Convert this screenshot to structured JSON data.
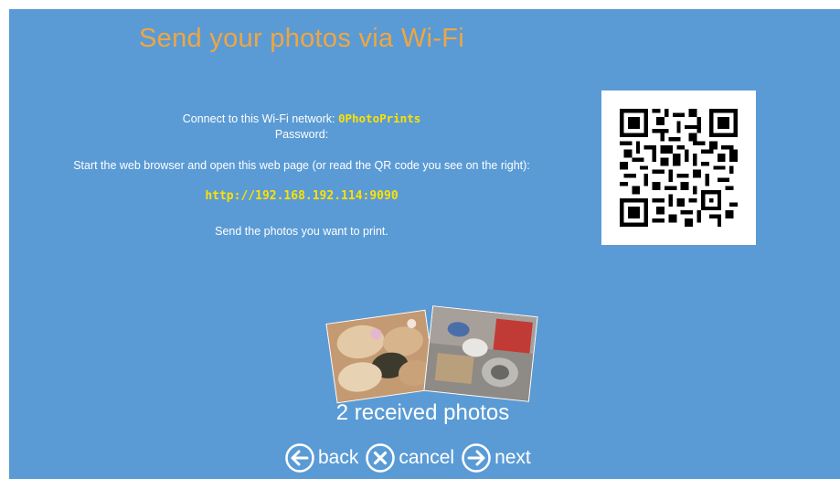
{
  "header": {
    "title": "Send your photos via Wi-Fi"
  },
  "instructions": {
    "network_prefix": "Connect to this Wi-Fi network: ",
    "network_name": "0PhotoPrints",
    "password_label": "Password:",
    "browser_text": "Start the web browser and open this web page (or read the QR code you see on the right):",
    "url": "http://192.168.192.114:9090",
    "send_text": "Send the photos you want to print."
  },
  "qr": {
    "icon": "qr-code"
  },
  "received": {
    "label": "2 received photos",
    "count": 2
  },
  "nav": {
    "back_label": "back",
    "cancel_label": "cancel",
    "next_label": "next"
  },
  "colors": {
    "background": "#5a9bd5",
    "title": "#f0a640",
    "highlight": "#ffe100"
  }
}
